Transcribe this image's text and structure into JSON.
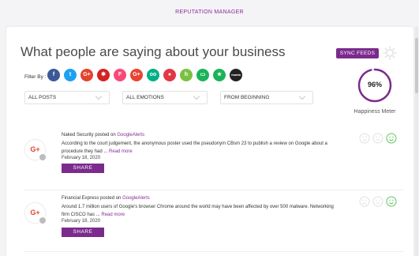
{
  "app": {
    "title": "REPUTATION MANAGER"
  },
  "header": {
    "heading": "What people are saying about your business",
    "sync_label": "SYNC FEEDS"
  },
  "filter": {
    "label": "Filter By :",
    "sources": [
      {
        "name": "facebook-icon",
        "glyph": "f",
        "color": "#3b5998"
      },
      {
        "name": "twitter-icon",
        "glyph": "t",
        "color": "#1da1f2"
      },
      {
        "name": "google-plus-icon",
        "glyph": "G+",
        "color": "#e4432d"
      },
      {
        "name": "yelp-icon",
        "glyph": "✱",
        "color": "#d32323"
      },
      {
        "name": "foursquare-icon",
        "glyph": "F",
        "color": "#f94877"
      },
      {
        "name": "google-plus-alt-icon",
        "glyph": "G+",
        "color": "#ea4335"
      },
      {
        "name": "tripadvisor-icon",
        "glyph": "oo",
        "color": "#00af87"
      },
      {
        "name": "zomato-icon",
        "glyph": "●",
        "color": "#e23744"
      },
      {
        "name": "houzz-icon",
        "glyph": "h",
        "color": "#7ac142"
      },
      {
        "name": "chat-icon",
        "glyph": "▭",
        "color": "#1bb35a"
      },
      {
        "name": "star-icon",
        "glyph": "★",
        "color": "#1bb35a"
      },
      {
        "name": "manta-icon",
        "glyph": "manta",
        "color": "#222222"
      }
    ],
    "dropdowns": [
      {
        "value": "ALL POSTS"
      },
      {
        "value": "ALL EMOTIONS"
      },
      {
        "value": "FROM BEGINNING"
      }
    ]
  },
  "meter": {
    "value": "96%",
    "percent": 96,
    "label": "Happiness Meter",
    "color": "#7b2b8d"
  },
  "posts": [
    {
      "publisher": "Naked Security",
      "posted_on": "posted on",
      "source": "GoogleAlerts",
      "text": "According to the court judgement, the anonymous poster used the pseudonym CBsm 23 to publish a review on Google about a procedure they had ...",
      "read_more": "Read more",
      "date": "February 18, 2020",
      "share": "SHARE"
    },
    {
      "publisher": "Financial Express",
      "posted_on": "posted on",
      "source": "GoogleAlerts",
      "text": "Around 1.7 million users of Google's browser Chrome around the world may have been affected by over 500 malware. Networking firm CISCO has ...",
      "read_more": "Read more",
      "date": "February 18, 2020",
      "share": "SHARE"
    }
  ],
  "colors": {
    "accent": "#7b2b8d",
    "positive": "#62c462"
  }
}
